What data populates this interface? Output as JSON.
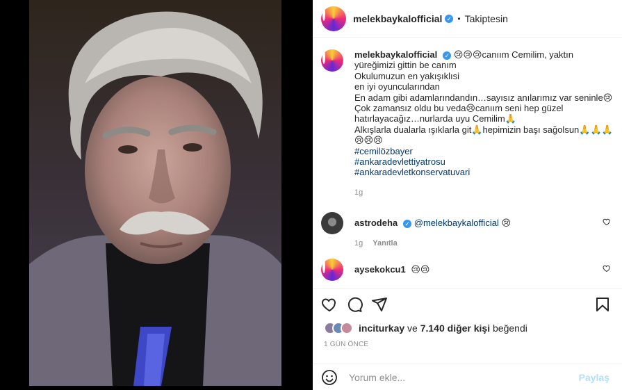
{
  "header": {
    "username": "melekbaykalofficial",
    "separator": "•",
    "follow_state": "Takiptesin"
  },
  "caption": {
    "username": "melekbaykalofficial",
    "lines": [
      "😢😢😢canıım Cemilim, yaktın yüreğimizi gittin be canım",
      "Okulumuzun en yakışıklısi",
      "en iyi oyuncularından",
      "En adam gibi adamlarındandın…sayısız anılarımız var seninle😢",
      "Çok zamansız oldu bu veda😢canıım seni hep güzel hatırlayacağız…nurlarda uyu Cemilim🙏",
      "Alkışlarla dualarla ışıklarla git🙏hepimizin başı sağolsun🙏🙏🙏😢😢😢"
    ],
    "hashtags": [
      "#cemilözbayer",
      "#ankaradevlettiyatrosu",
      "#ankaradevletkonservatuvari"
    ],
    "time": "1g"
  },
  "comments": [
    {
      "username": "astrodeha",
      "mention": "@melekbaykalofficial",
      "text": " 😢",
      "time": "1g",
      "reply_label": "Yanıtla"
    },
    {
      "username": "aysekokcu1",
      "text": "😢😢"
    }
  ],
  "likes": {
    "first_user": "inciturkay",
    "connector": "ve",
    "others": "7.140 diğer kişi",
    "suffix": "beğendi"
  },
  "timestamp": "1 GÜN ÖNCE",
  "add_comment": {
    "placeholder": "Yorum ekle...",
    "post_label": "Paylaş"
  },
  "colors": {
    "verified": "#3897f0",
    "link": "#00376b",
    "muted": "#8e8e8e",
    "post_disabled": "#b2dffc"
  },
  "icons": [
    "verified-badge-icon",
    "heart-icon",
    "comment-icon",
    "share-icon",
    "bookmark-icon",
    "emoji-icon",
    "small-heart-icon"
  ]
}
